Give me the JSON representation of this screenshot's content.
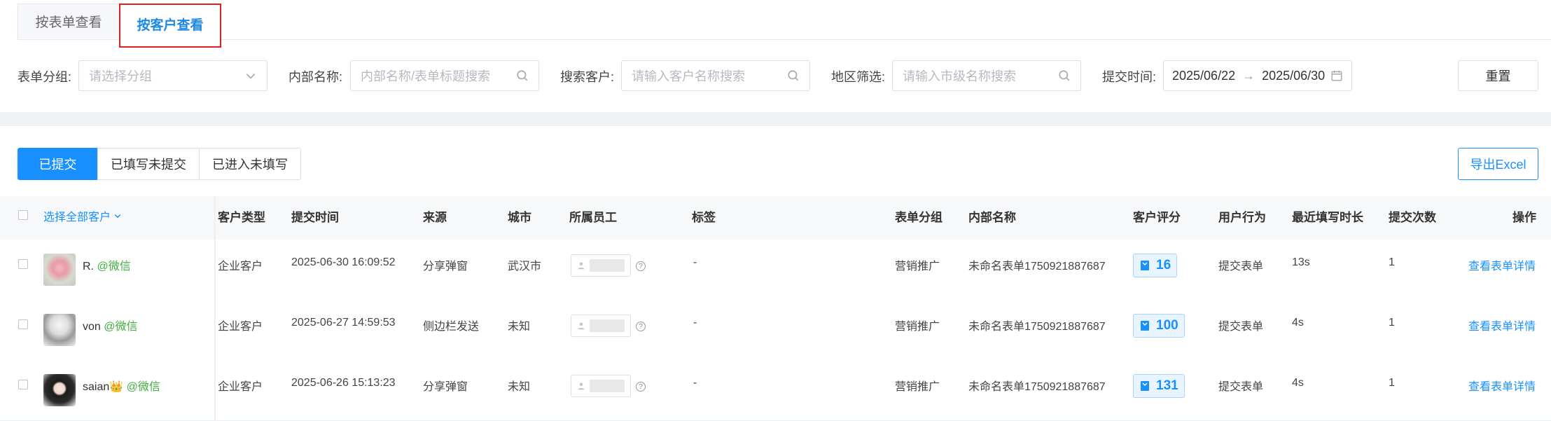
{
  "tabs": {
    "by_form": "按表单查看",
    "by_customer": "按客户查看"
  },
  "filters": {
    "group_label": "表单分组:",
    "group_placeholder": "请选择分组",
    "internal_label": "内部名称:",
    "internal_placeholder": "内部名称/表单标题搜索",
    "customer_label": "搜索客户:",
    "customer_placeholder": "请输入客户名称搜索",
    "region_label": "地区筛选:",
    "region_placeholder": "请输入市级名称搜索",
    "time_label": "提交时间:",
    "date_start": "2025/06/22",
    "date_sep": "→",
    "date_end": "2025/06/30",
    "reset": "重置"
  },
  "status_tabs": [
    "已提交",
    "已填写未提交",
    "已进入未填写"
  ],
  "export": "导出Excel",
  "table": {
    "select_all": "选择全部客户",
    "headers": [
      "客户类型",
      "提交时间",
      "来源",
      "城市",
      "所属员工",
      "标签",
      "表单分组",
      "内部名称",
      "客户评分",
      "用户行为",
      "最近填写时长",
      "提交次数",
      "操作"
    ],
    "rows": [
      {
        "name": "R.",
        "channel": "@微信",
        "type": "企业客户",
        "time": "2025-06-30 16:09:52",
        "source": "分享弹窗",
        "city": "武汉市",
        "tag": "-",
        "group": "营销推广",
        "internal": "未命名表单1750921887687",
        "score": "16",
        "behavior": "提交表单",
        "duration": "13s",
        "count": "1",
        "action": "查看表单详情"
      },
      {
        "name": "von",
        "channel": "@微信",
        "type": "企业客户",
        "time": "2025-06-27 14:59:53",
        "source": "侧边栏发送",
        "city": "未知",
        "tag": "-",
        "group": "营销推广",
        "internal": "未命名表单1750921887687",
        "score": "100",
        "behavior": "提交表单",
        "duration": "4s",
        "count": "1",
        "action": "查看表单详情"
      },
      {
        "name": "saian👑",
        "channel": "@微信",
        "type": "企业客户",
        "time": "2025-06-26 15:13:23",
        "source": "分享弹窗",
        "city": "未知",
        "tag": "-",
        "group": "营销推广",
        "internal": "未命名表单1750921887687",
        "score": "131",
        "behavior": "提交表单",
        "duration": "4s",
        "count": "1",
        "action": "查看表单详情"
      }
    ]
  },
  "colors": {
    "accent": "#1890ff",
    "highlight_border": "#e02020",
    "wechat": "#3fae3f"
  }
}
